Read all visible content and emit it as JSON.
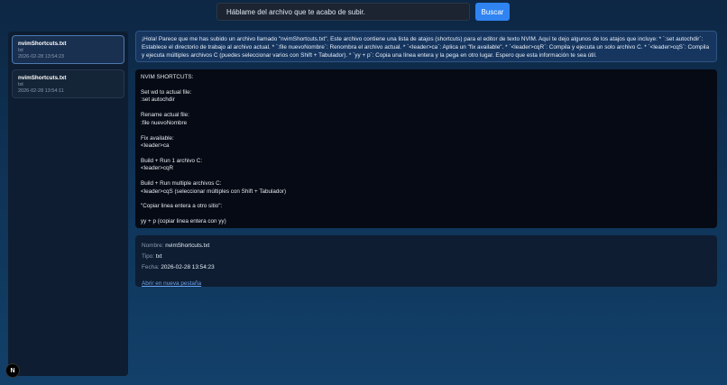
{
  "search": {
    "placeholder": "Háblame del archivo que te acabo de subir.",
    "button_label": "Buscar"
  },
  "files": [
    {
      "name": "nvimShortcuts.txt",
      "type": "txt",
      "date": "2026-02-28 13:54:23"
    },
    {
      "name": "nvimShortcuts.txt",
      "type": "txt",
      "date": "2026-02-28 13:54:11"
    }
  ],
  "summary": "¡Hola! Parece que me has subido un archivo llamado \"nvimShortcuts.txt\". Este archivo contiene una lista de atajos (shortcuts) para el editor de texto NVIM. Aquí te dejo algunos de los atajos que incluye: * `:set autochdir`: Establece el directorio de trabajo al archivo actual. * `:file nuevoNombre`: Renombra el archivo actual. * `<leader>ca`: Aplica un \"fix available\". * `<leader>cqR`: Compila y ejecuta un solo archivo C. * `<leader>cqS`: Compila y ejecuta múltiples archivos C (puedes seleccionar varios con Shift + Tabulador). * `yy + p`: Copia una línea entera y la pega en otro lugar. Espero que esta información te sea útil.",
  "content_lines": [
    "NVIM SHORTCUTS:",
    "",
    "Set wd to actual file:",
    ":set autochdir",
    "",
    "Rename actual file:",
    ":file nuevoNombre",
    "",
    "Fix available:",
    "<leader>ca",
    "",
    "Build + Run 1 archivo C:",
    "<leader>cqR",
    "",
    "Build + Run multiple archivos C:",
    "<leader>cqS (seleccionar múltiples con Shift + Tabulador)",
    "",
    "\"Copiar linea entera a otro sitio\":",
    "",
    "yy + p (copiar linea entera con yy)"
  ],
  "meta": {
    "name_label": "Nombre:",
    "name_value": "nvimShortcuts.txt",
    "type_label": "Tipo:",
    "type_value": "txt",
    "date_label": "Fecha:",
    "date_value": "2026-02-28 13:54:23",
    "open_link": "Abrir en nueva pestaña"
  },
  "badge": {
    "letter": "N",
    "icon": "nextjs-logo-icon"
  }
}
